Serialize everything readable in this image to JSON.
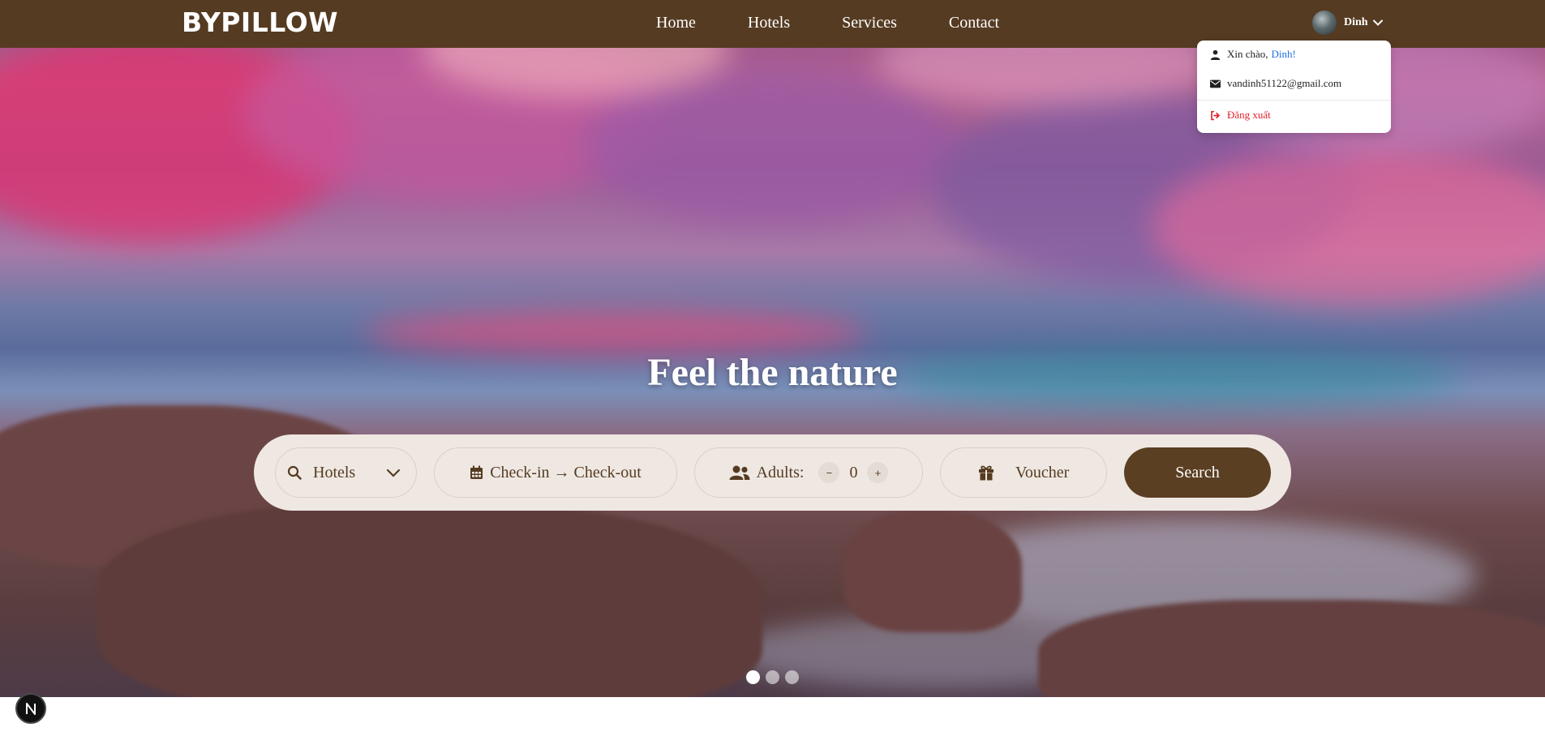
{
  "brand": {
    "logo_text": "BYPILLOW"
  },
  "nav": {
    "links": [
      {
        "label": "Home"
      },
      {
        "label": "Hotels"
      },
      {
        "label": "Services"
      },
      {
        "label": "Contact"
      }
    ]
  },
  "user": {
    "name": "Dinh",
    "menu": {
      "greeting": "Xin chào,",
      "greeting_name": "Dinh!",
      "email": "vandinh51122@gmail.com",
      "logout_label": "Đăng xuất"
    }
  },
  "hero": {
    "title": "Feel the nature",
    "slides_total": 3,
    "active_slide": 1
  },
  "search": {
    "category_selected": "Hotels",
    "dates_label": "Check-in → Check-out",
    "adults_label": "Adults:",
    "adults_count": "0",
    "voucher_label": "Voucher",
    "button_label": "Search"
  },
  "icons": {
    "search": "search-icon",
    "calendar": "calendar-icon",
    "users": "users-icon",
    "gift": "gift-icon",
    "user": "user-icon",
    "envelope": "envelope-icon",
    "logout": "sign-out-icon",
    "chevron": "chevron-down-icon"
  },
  "colors": {
    "navbar": "#553b22",
    "search_bar_bg": "#efe8e2",
    "button": "#5b3f23",
    "logout_text": "#e0202b",
    "greeting_name": "#1f6fe0"
  }
}
